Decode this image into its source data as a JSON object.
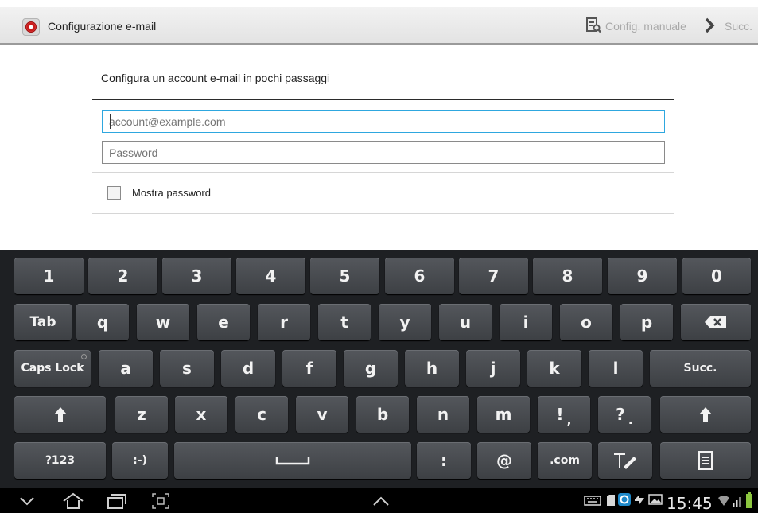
{
  "action_bar": {
    "title": "Configurazione e-mail",
    "manual_config_label": "Config. manuale",
    "next_label": "Succ."
  },
  "form": {
    "heading": "Configura un account e-mail in pochi passaggi",
    "email_placeholder": "account@example.com",
    "email_value": "",
    "password_placeholder": "Password",
    "password_value": "",
    "show_password_label": "Mostra password",
    "show_password_checked": false
  },
  "keyboard": {
    "numbers": [
      "1",
      "2",
      "3",
      "4",
      "5",
      "6",
      "7",
      "8",
      "9",
      "0"
    ],
    "tab": "Tab",
    "row_q": [
      "q",
      "w",
      "e",
      "r",
      "t",
      "y",
      "u",
      "i",
      "o",
      "p"
    ],
    "caps_lock": "Caps Lock",
    "row_a": [
      "a",
      "s",
      "d",
      "f",
      "g",
      "h",
      "j",
      "k",
      "l"
    ],
    "enter": "Succ.",
    "row_z": [
      "z",
      "x",
      "c",
      "v",
      "b",
      "n",
      "m"
    ],
    "excl": "!",
    "comma": ",",
    "quest": "?",
    "period": ".",
    "sym": "?123",
    "smiley": ":-)",
    "colon": ":",
    "at": "@",
    "dotcom": ".com"
  },
  "status_bar": {
    "time": "15:45"
  },
  "colors": {
    "accent_focus": "#2ea7df",
    "keyboard_bg": "#1e2023",
    "key_bg": "#484b50"
  }
}
